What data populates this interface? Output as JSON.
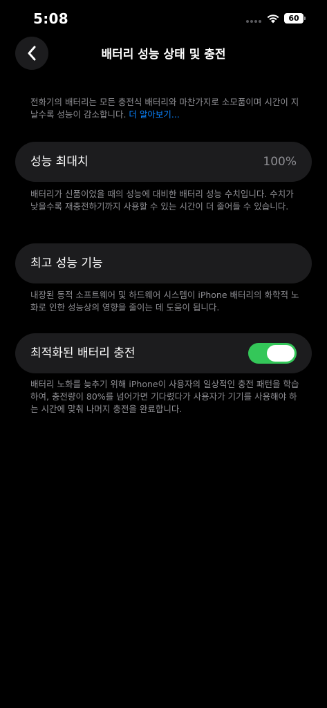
{
  "status_bar": {
    "time": "5:08",
    "battery": "60",
    "icons": [
      "signal-dots-icon",
      "wifi-icon",
      "battery-icon"
    ]
  },
  "header": {
    "title": "배터리 성능 상태 및 충전",
    "back_icon": "chevron-left-icon"
  },
  "intro": {
    "text": "전화기의 배터리는 모든 충전식 배터리와 마찬가지로 소모품이며 시간이 지날수록 성능이 감소합니다. ",
    "link": "더 알아보기..."
  },
  "max_capacity": {
    "label": "성능 최대치",
    "value": "100%",
    "description": "배터리가 신품이었을 때의 성능에 대비한 배터리 성능 수치입니다. 수치가 낮을수록 재충전하기까지 사용할 수 있는 시간이 더 줄어들 수 있습니다."
  },
  "peak_performance": {
    "label": "최고 성능 기능",
    "description": "내장된 동적 소프트웨어 및 하드웨어 시스템이 iPhone 배터리의 화학적 노화로 인한 성능상의 영향을 줄이는 데 도움이 됩니다."
  },
  "optimized_charging": {
    "label": "최적화된 배터리 충전",
    "enabled": true,
    "description": "배터리 노화를 늦추기 위해 iPhone이 사용자의 일상적인 충전 패턴을 학습하여, 충전량이 80%를 넘어가면 기다렸다가 사용자가 기기를 사용해야 하는 시간에 맞춰 나머지 충전을 완료합니다."
  },
  "colors": {
    "background": "#000000",
    "card": "#1c1c1e",
    "secondary_text": "#8e8e93",
    "link": "#0a84ff",
    "toggle_on": "#34c759"
  }
}
